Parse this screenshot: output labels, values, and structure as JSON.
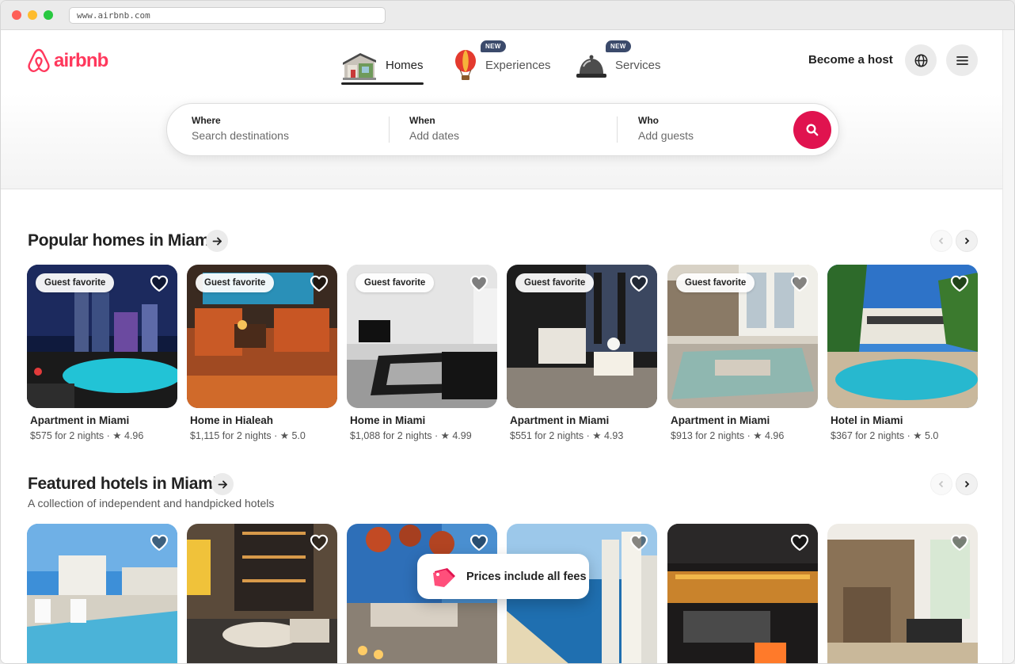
{
  "browser": {
    "url": "www.airbnb.com"
  },
  "header": {
    "logo_text": "airbnb",
    "brand_color": "#ff385c",
    "tabs": [
      {
        "label": "Homes",
        "icon": "house-icon",
        "active": true,
        "badge": ""
      },
      {
        "label": "Experiences",
        "icon": "hot-air-balloon-icon",
        "active": false,
        "badge": "NEW"
      },
      {
        "label": "Services",
        "icon": "service-bell-icon",
        "active": false,
        "badge": "NEW"
      }
    ],
    "become_host": "Become a host",
    "globe_icon": "globe-icon",
    "menu_icon": "menu-icon"
  },
  "search": {
    "where_label": "Where",
    "where_placeholder": "Search destinations",
    "when_label": "When",
    "when_placeholder": "Add dates",
    "who_label": "Who",
    "who_placeholder": "Add guests",
    "button_color": "#e0134f"
  },
  "sections": [
    {
      "title": "Popular homes in Miami",
      "subtitle": "",
      "cards": [
        {
          "badge": "Guest favorite",
          "title": "Apartment in Miami",
          "price": "$575 for 2 nights",
          "rating": "4.96"
        },
        {
          "badge": "Guest favorite",
          "title": "Home in Hialeah",
          "price": "$1,115 for 2 nights",
          "rating": "5.0"
        },
        {
          "badge": "Guest favorite",
          "title": "Home in Miami",
          "price": "$1,088 for 2 nights",
          "rating": "4.99"
        },
        {
          "badge": "Guest favorite",
          "title": "Apartment in Miami",
          "price": "$551 for 2 nights",
          "rating": "4.93"
        },
        {
          "badge": "Guest favorite",
          "title": "Apartment in Miami",
          "price": "$913 for 2 nights",
          "rating": "4.96"
        },
        {
          "badge": "",
          "title": "Hotel in Miami",
          "price": "$367 for 2 nights",
          "rating": "5.0"
        }
      ]
    },
    {
      "title": "Featured hotels in Miami",
      "subtitle": "A collection of independent and handpicked hotels",
      "cards": [
        {},
        {},
        {},
        {},
        {},
        {}
      ]
    }
  ],
  "toast": {
    "text": "Prices include all fees",
    "icon": "price-tag-icon"
  }
}
